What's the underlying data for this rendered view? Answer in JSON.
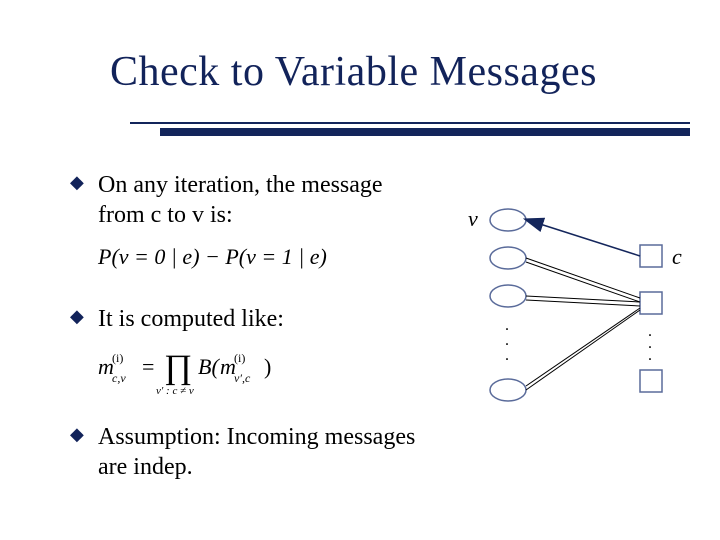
{
  "title": "Check to Variable Messages",
  "bullets": {
    "b1": "On any iteration, the message from c to v is:",
    "b2": "It is computed like:",
    "b3": "Assumption: Incoming messages are indep."
  },
  "formulas": {
    "p_left": "P(v = 0 | e) − P(v = 1 | e)",
    "m_lhs_base": "m",
    "m_lhs_sub": "c,v",
    "m_lhs_sup": "(i)",
    "eq": "=",
    "prod_sub": "v′ : c ≠ v",
    "B": "B(",
    "m_rhs_base": "m",
    "m_rhs_sub": "v′,c",
    "m_rhs_sup": "(i)",
    "close": ")"
  },
  "labels": {
    "v": "v",
    "c": "c"
  },
  "colors": {
    "title": "#12235a",
    "body": "#000000",
    "node_stroke": "#5a6b9a",
    "arrow": "#14265c"
  }
}
